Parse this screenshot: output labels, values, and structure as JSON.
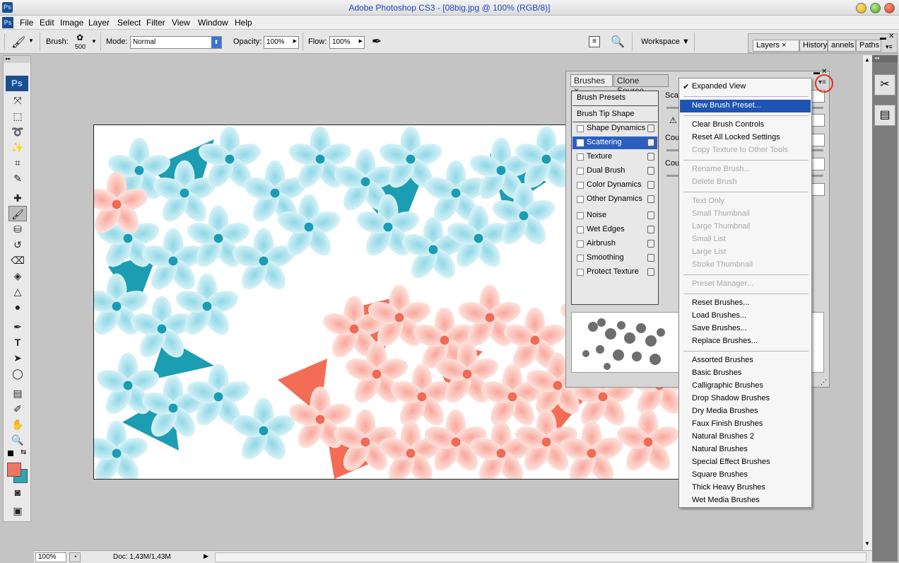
{
  "window": {
    "app_icon": "Ps",
    "title": "Adobe Photoshop CS3 - [08big.jpg @ 100% (RGB/8)]"
  },
  "menubar": {
    "items": [
      "File",
      "Edit",
      "Image",
      "Layer",
      "Select",
      "Filter",
      "View",
      "Window",
      "Help"
    ]
  },
  "options": {
    "brush_label": "Brush:",
    "brush_size": "500",
    "mode_label": "Mode:",
    "mode_value": "Normal",
    "opacity_label": "Opacity:",
    "opacity_value": "100%",
    "flow_label": "Flow:",
    "flow_value": "100%",
    "workspace_label": "Workspace ▼"
  },
  "dock": {
    "tabs": [
      "Layers ×",
      "History",
      "annels",
      "Paths"
    ]
  },
  "toolbox": {
    "ps_logo": "Ps"
  },
  "brushes_panel": {
    "tabs": [
      "Brushes ×",
      "Clone Source"
    ],
    "presets_label": "Brush Presets",
    "tip_shape_label": "Brush Tip Shape",
    "options": [
      {
        "label": "Shape Dynamics",
        "checked": false
      },
      {
        "label": "Scattering",
        "checked": true,
        "selected": true
      },
      {
        "label": "Texture",
        "checked": false
      },
      {
        "label": "Dual Brush",
        "checked": false
      },
      {
        "label": "Color Dynamics",
        "checked": false
      },
      {
        "label": "Other Dynamics",
        "checked": false
      },
      {
        "label": "Noise",
        "checked": false
      },
      {
        "label": "Wet Edges",
        "checked": false
      },
      {
        "label": "Airbrush",
        "checked": false
      },
      {
        "label": "Smoothing",
        "checked": false
      },
      {
        "label": "Protect Texture",
        "checked": false
      }
    ],
    "right_labels": [
      "Scat",
      "Cou",
      "Cou"
    ]
  },
  "flyout": {
    "groups": [
      [
        {
          "label": "Expanded View",
          "checked": true
        }
      ],
      [
        {
          "label": "New Brush Preset...",
          "highlighted": true
        }
      ],
      [
        {
          "label": "Clear Brush Controls"
        },
        {
          "label": "Reset All Locked Settings"
        },
        {
          "label": "Copy Texture to Other Tools",
          "disabled": true
        }
      ],
      [
        {
          "label": "Rename Brush...",
          "disabled": true
        },
        {
          "label": "Delete Brush",
          "disabled": true
        }
      ],
      [
        {
          "label": "Text Only",
          "disabled": true
        },
        {
          "label": "Small Thumbnail",
          "disabled": true
        },
        {
          "label": "Large Thumbnail",
          "disabled": true
        },
        {
          "label": "Small List",
          "disabled": true
        },
        {
          "label": "Large List",
          "disabled": true
        },
        {
          "label": "Stroke Thumbnail",
          "disabled": true
        }
      ],
      [
        {
          "label": "Preset Manager...",
          "disabled": true
        }
      ],
      [
        {
          "label": "Reset Brushes..."
        },
        {
          "label": "Load Brushes..."
        },
        {
          "label": "Save Brushes..."
        },
        {
          "label": "Replace Brushes..."
        }
      ],
      [
        {
          "label": "Assorted Brushes"
        },
        {
          "label": "Basic Brushes"
        },
        {
          "label": "Calligraphic Brushes"
        },
        {
          "label": "Drop Shadow Brushes"
        },
        {
          "label": "Dry Media Brushes"
        },
        {
          "label": "Faux Finish Brushes"
        },
        {
          "label": "Natural Brushes 2"
        },
        {
          "label": "Natural Brushes"
        },
        {
          "label": "Special Effect Brushes"
        },
        {
          "label": "Square Brushes"
        },
        {
          "label": "Thick Heavy Brushes"
        },
        {
          "label": "Wet Media Brushes"
        }
      ]
    ]
  },
  "status": {
    "zoom": "100%",
    "doc": "Doc: 1,43M/1,43M"
  },
  "colors": {
    "foreground": "#f07565",
    "background": "#2aa6b5",
    "highlight": "#1f55b2",
    "annotation": "#e03214"
  }
}
